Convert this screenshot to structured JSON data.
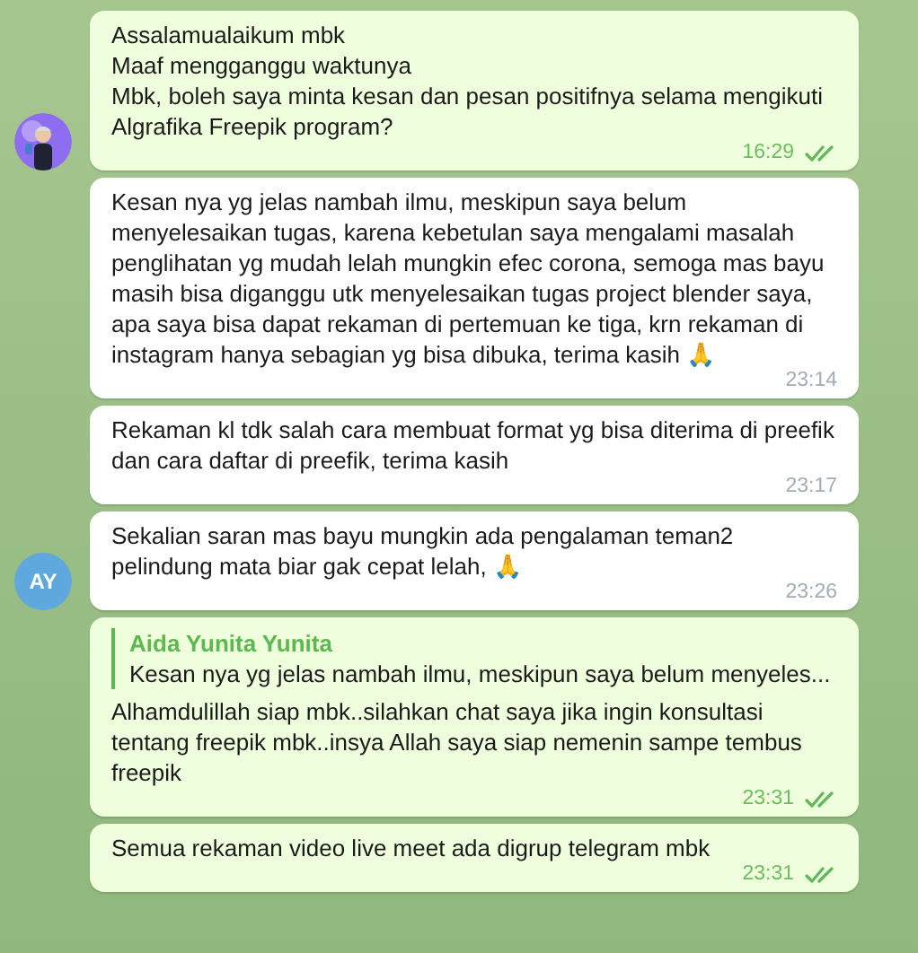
{
  "messages": [
    {
      "kind": "outgoing",
      "text": "Assalamualaikum mbk\nMaaf mengganggu waktunya\nMbk, boleh saya minta kesan dan pesan positifnya selama mengikuti Algrafika Freepik program?",
      "time": "16:29",
      "read": true
    },
    {
      "kind": "incoming",
      "text": "Kesan nya yg jelas nambah ilmu, meskipun saya belum menyelesaikan tugas, karena kebetulan saya mengalami masalah penglihatan yg mudah lelah mungkin efec corona, semoga mas bayu masih bisa diganggu utk menyelesaikan tugas  project blender saya, apa saya bisa dapat rekaman di pertemuan ke tiga, krn rekaman di instagram hanya sebagian yg bisa dibuka, terima kasih 🙏",
      "time": "23:14"
    },
    {
      "kind": "incoming",
      "text": "Rekaman kl tdk salah cara membuat format yg bisa diterima di preefik dan cara daftar di preefik, terima kasih",
      "time": "23:17"
    },
    {
      "kind": "incoming",
      "text": "Sekalian saran mas bayu mungkin ada pengalaman teman2 pelindung mata biar gak cepat lelah, 🙏",
      "time": "23:26",
      "avatar": {
        "kind": "initials",
        "text": "AY"
      }
    },
    {
      "kind": "outgoing",
      "reply": {
        "author": "Aida Yunita Yunita",
        "text": "Kesan nya yg jelas nambah ilmu, meskipun saya belum menyeles..."
      },
      "text": "Alhamdulillah siap mbk..silahkan chat saya jika ingin konsultasi tentang freepik mbk..insya Allah saya siap nemenin sampe tembus freepik",
      "time": "23:31",
      "read": true
    },
    {
      "kind": "outgoing",
      "text": "Semua rekaman video live meet ada digrup telegram mbk",
      "time": "23:31",
      "read": true
    }
  ]
}
